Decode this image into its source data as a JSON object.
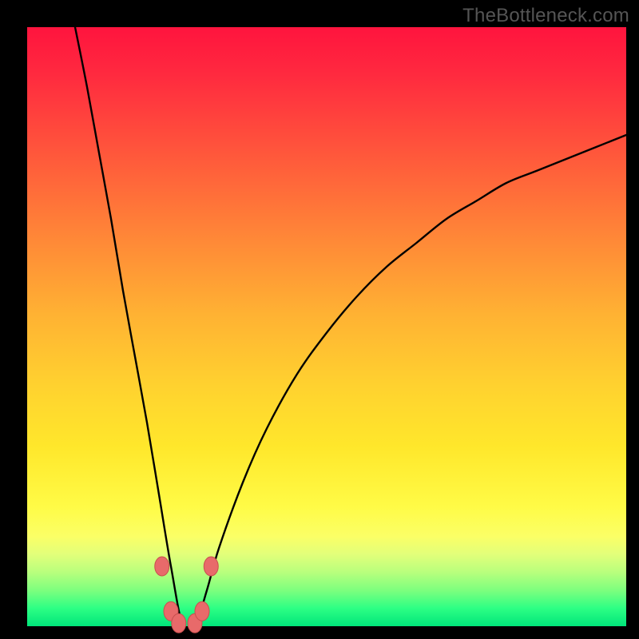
{
  "watermark": "TheBottleneck.com",
  "colors": {
    "frame": "#000000",
    "curve_stroke": "#000000",
    "marker_fill": "#e86a6a",
    "marker_stroke": "#c94f4f"
  },
  "chart_data": {
    "type": "line",
    "title": "",
    "xlabel": "",
    "ylabel": "",
    "xlim": [
      0,
      100
    ],
    "ylim": [
      0,
      100
    ],
    "grid": false,
    "note": "V-shaped bottleneck curve over vertical color gradient (red=high bottleneck, green=low). Y estimated from curve height, X is horizontal position %. Minimum sits near x≈26 at y≈0.",
    "series": [
      {
        "name": "bottleneck-curve",
        "x": [
          8,
          10,
          12,
          14,
          16,
          18,
          20,
          22,
          24,
          26,
          28,
          30,
          32,
          36,
          40,
          45,
          50,
          55,
          60,
          65,
          70,
          75,
          80,
          85,
          90,
          95,
          100
        ],
        "y": [
          100,
          90,
          79,
          68,
          56,
          45,
          34,
          22,
          10,
          0,
          0,
          6,
          13,
          24,
          33,
          42,
          49,
          55,
          60,
          64,
          68,
          71,
          74,
          76,
          78,
          80,
          82
        ]
      }
    ],
    "markers": {
      "name": "highlight-points",
      "points": [
        {
          "x": 22.5,
          "y": 10
        },
        {
          "x": 24.0,
          "y": 2.5
        },
        {
          "x": 25.3,
          "y": 0.5
        },
        {
          "x": 28.0,
          "y": 0.5
        },
        {
          "x": 29.2,
          "y": 2.5
        },
        {
          "x": 30.7,
          "y": 10
        }
      ]
    },
    "gradient_stops": [
      {
        "pct": 0,
        "color": "#ff143e"
      },
      {
        "pct": 22,
        "color": "#ff5a3b"
      },
      {
        "pct": 48,
        "color": "#ffb233"
      },
      {
        "pct": 70,
        "color": "#ffe72b"
      },
      {
        "pct": 85,
        "color": "#fbff66"
      },
      {
        "pct": 94,
        "color": "#7dff7e"
      },
      {
        "pct": 100,
        "color": "#00e57a"
      }
    ]
  }
}
